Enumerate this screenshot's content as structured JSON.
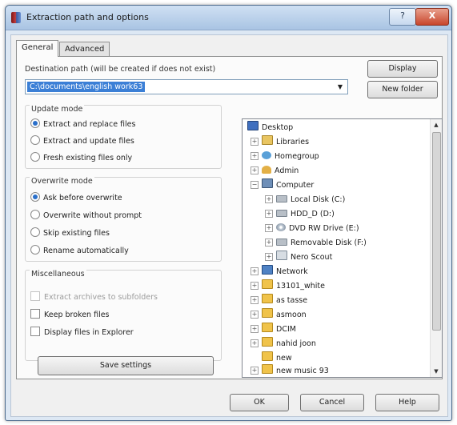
{
  "window": {
    "title": "Extraction path and options",
    "help_label": "?",
    "close_label": "X"
  },
  "tabs": [
    {
      "label": "General"
    },
    {
      "label": "Advanced"
    }
  ],
  "destination": {
    "label": "Destination path (will be created if does not exist)",
    "value": "C:\\documents\\english work63",
    "display_label": "Display",
    "new_folder_label": "New folder"
  },
  "update_mode": {
    "title": "Update mode",
    "options": [
      {
        "label": "Extract and replace files",
        "selected": true
      },
      {
        "label": "Extract and update files",
        "selected": false
      },
      {
        "label": "Fresh existing files only",
        "selected": false
      }
    ]
  },
  "overwrite_mode": {
    "title": "Overwrite mode",
    "options": [
      {
        "label": "Ask before overwrite",
        "selected": true
      },
      {
        "label": "Overwrite without prompt",
        "selected": false
      },
      {
        "label": "Skip existing files",
        "selected": false
      },
      {
        "label": "Rename automatically",
        "selected": false
      }
    ]
  },
  "misc": {
    "title": "Miscellaneous",
    "options": [
      {
        "label": "Extract archives to subfolders",
        "checked": false,
        "disabled": true
      },
      {
        "label": "Keep broken files",
        "checked": false,
        "disabled": false
      },
      {
        "label": "Display files in Explorer",
        "checked": false,
        "disabled": false
      }
    ]
  },
  "save_settings_label": "Save settings",
  "tree": {
    "items": [
      {
        "label": "Desktop",
        "icon": "desktop-icon"
      },
      {
        "label": "Libraries",
        "icon": "libraries-icon"
      },
      {
        "label": "Homegroup",
        "icon": "homegroup-icon"
      },
      {
        "label": "Admin",
        "icon": "user-icon"
      },
      {
        "label": "Computer",
        "icon": "computer-icon"
      },
      {
        "label": "Local Disk (C:)",
        "icon": "disk-icon"
      },
      {
        "label": "HDD_D (D:)",
        "icon": "disk-icon"
      },
      {
        "label": "DVD RW Drive (E:)",
        "icon": "dvd-icon"
      },
      {
        "label": "Removable Disk (F:)",
        "icon": "disk-icon"
      },
      {
        "label": "Nero Scout",
        "icon": "nero-scout-icon"
      },
      {
        "label": "Network",
        "icon": "network-icon"
      },
      {
        "label": "13101_white",
        "icon": "folder-icon"
      },
      {
        "label": "as tasse",
        "icon": "folder-icon"
      },
      {
        "label": "asmoon",
        "icon": "folder-icon"
      },
      {
        "label": "DCIM",
        "icon": "folder-icon"
      },
      {
        "label": "nahid joon",
        "icon": "folder-icon"
      },
      {
        "label": "new",
        "icon": "folder-icon"
      },
      {
        "label": "new music 93",
        "icon": "folder-icon"
      }
    ]
  },
  "buttons": {
    "ok": "OK",
    "cancel": "Cancel",
    "help": "Help"
  }
}
